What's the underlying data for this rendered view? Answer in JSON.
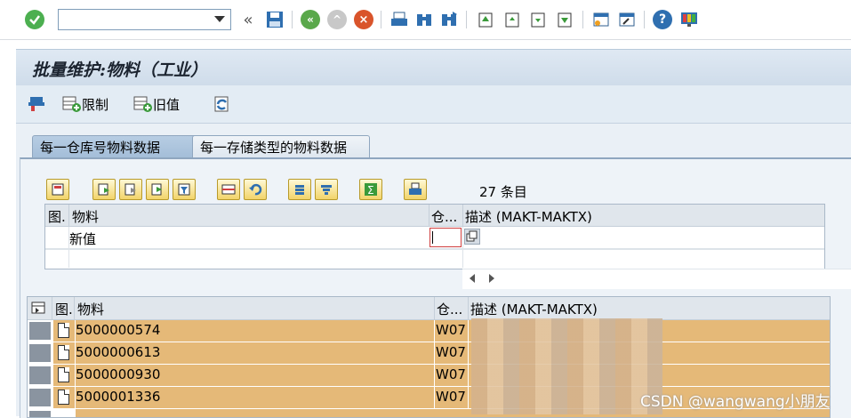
{
  "title": "批量维护:物料（工业）",
  "app_toolbar": {
    "restrict_label": "限制",
    "old_value_label": "旧值"
  },
  "tabs": [
    {
      "label": "每一仓库号物料数据",
      "active": true
    },
    {
      "label": "每一存储类型的物料数据",
      "active": false
    }
  ],
  "entries_count": "27 条目",
  "edit_grid": {
    "columns": [
      "图.",
      "物料",
      "仓...",
      "描述 (MAKT-MAKTX)"
    ],
    "row_label": "新值"
  },
  "list_grid": {
    "columns": [
      "图.",
      "物料",
      "仓...",
      "描述 (MAKT-MAKTX)"
    ],
    "rows": [
      {
        "material": "5000000574",
        "warehouse": "W07"
      },
      {
        "material": "5000000613",
        "warehouse": "W07"
      },
      {
        "material": "5000000930",
        "warehouse": "W07"
      },
      {
        "material": "5000001336",
        "warehouse": "W07"
      }
    ]
  },
  "watermark": "CSDN @wangwang小朋友",
  "colors": {
    "row_highlight": "#e5b978",
    "title_bar": "#d6e3ef",
    "accent_green": "#3a9a3a"
  }
}
